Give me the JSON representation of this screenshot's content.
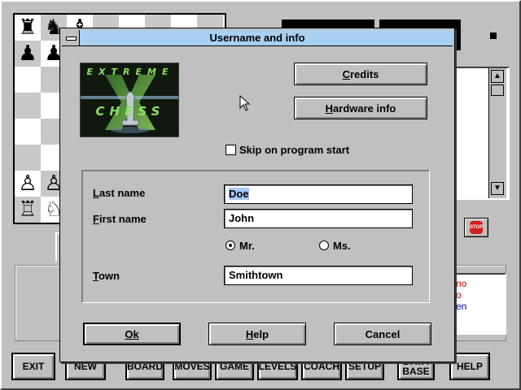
{
  "app": {
    "toolbar": [
      {
        "label": "EXIT"
      },
      {
        "label": "NEW"
      },
      {
        "label": "BOARD"
      },
      {
        "label": "MOVES"
      },
      {
        "label": "GAME"
      },
      {
        "label": "LEVELS"
      },
      {
        "label": "COACH"
      },
      {
        "label": "SETUP"
      },
      {
        "label": "DATA BASE"
      },
      {
        "label": "HELP"
      }
    ],
    "stop_label": "STOP",
    "side_text": [
      "no",
      "o",
      "en"
    ],
    "side_colors": [
      "#c00000",
      "#c00000",
      "#0000c0"
    ]
  },
  "dialog": {
    "title": "Username and info",
    "logo": {
      "top_text": "EXTREME",
      "bottom_text": "CHESS",
      "letter": "X"
    },
    "credits_label": "Credits",
    "credits_mnemonic": "C",
    "hardware_label": "Hardware info",
    "hardware_mnemonic": "H",
    "skip_label": "Skip on program start",
    "skip_checked": false,
    "last_name_label": "Last name",
    "last_name_value": "Doe",
    "first_name_label": "First name",
    "first_name_value": "John",
    "mr_label": "Mr.",
    "ms_label": "Ms.",
    "salutation_selected": "Mr.",
    "town_label": "Town",
    "town_value": "Smithtown",
    "ok_label": "Ok",
    "help_label": "Help",
    "cancel_label": "Cancel"
  },
  "colors": {
    "title_bar": "#a8d0f0",
    "face": "#c0c0c0",
    "selection": "#a8c8f0"
  }
}
